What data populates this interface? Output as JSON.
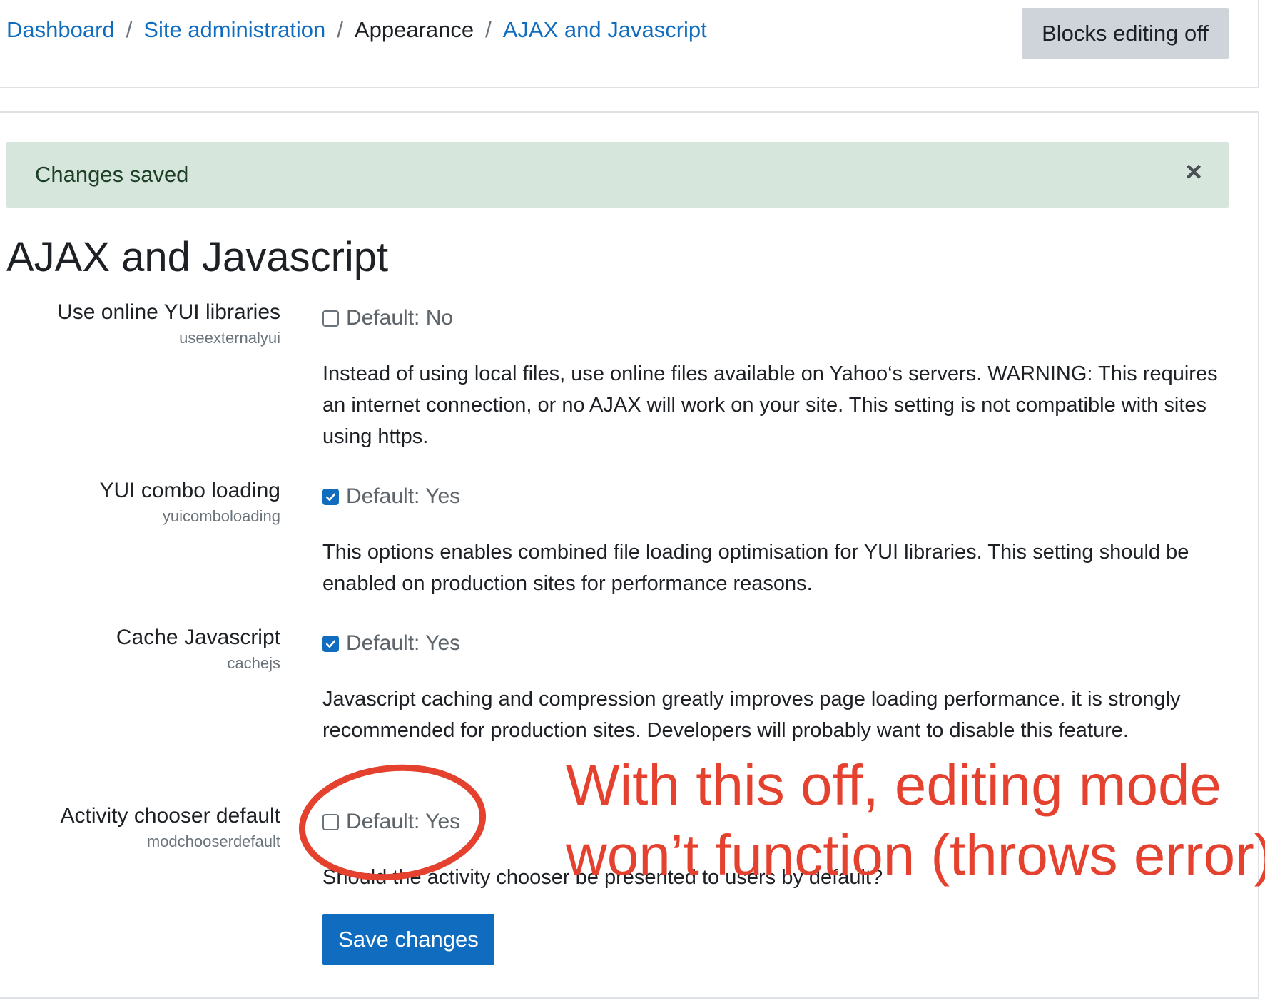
{
  "breadcrumb": {
    "items": [
      {
        "label": "Dashboard",
        "link": true
      },
      {
        "label": "Site administration",
        "link": true
      },
      {
        "label": "Appearance",
        "link": false
      },
      {
        "label": "AJAX and Javascript",
        "link": true
      }
    ],
    "separator": "/"
  },
  "header": {
    "blocks_button_label": "Blocks editing off"
  },
  "alert": {
    "message": "Changes saved",
    "close_symbol": "×",
    "close_icon": "close-icon"
  },
  "page": {
    "title": "AJAX and Javascript"
  },
  "settings": [
    {
      "label": "Use online YUI libraries",
      "key": "useexternalyui",
      "checked": false,
      "default_text": "Default: No",
      "description": "Instead of using local files, use online files available on Yahoo‘s servers. WARNING: This requires an internet connection, or no AJAX will work on your site. This setting is not compatible with sites using https."
    },
    {
      "label": "YUI combo loading",
      "key": "yuicomboloading",
      "checked": true,
      "default_text": "Default: Yes",
      "description": "This options enables combined file loading optimisation for YUI libraries. This setting should be enabled on production sites for performance reasons."
    },
    {
      "label": "Cache Javascript",
      "key": "cachejs",
      "checked": true,
      "default_text": "Default: Yes",
      "description": "Javascript caching and compression greatly improves page loading performance. it is strongly recommended for production sites. Developers will probably want to disable this feature."
    },
    {
      "label": "Activity chooser default",
      "key": "modchooserdefault",
      "checked": false,
      "default_text": "Default: Yes",
      "description": "Should the activity chooser be presented to users by default?"
    }
  ],
  "form": {
    "save_label": "Save changes"
  },
  "annotation": {
    "line1": "With this off, editing mode",
    "line2": "won’t function (throws error)",
    "color": "#e5412f"
  },
  "colors": {
    "link": "#0f6cbf",
    "primary_button": "#0f6cbf",
    "secondary_button": "#ced4da",
    "alert_bg": "#d7e6dc",
    "annotation": "#e5412f"
  }
}
